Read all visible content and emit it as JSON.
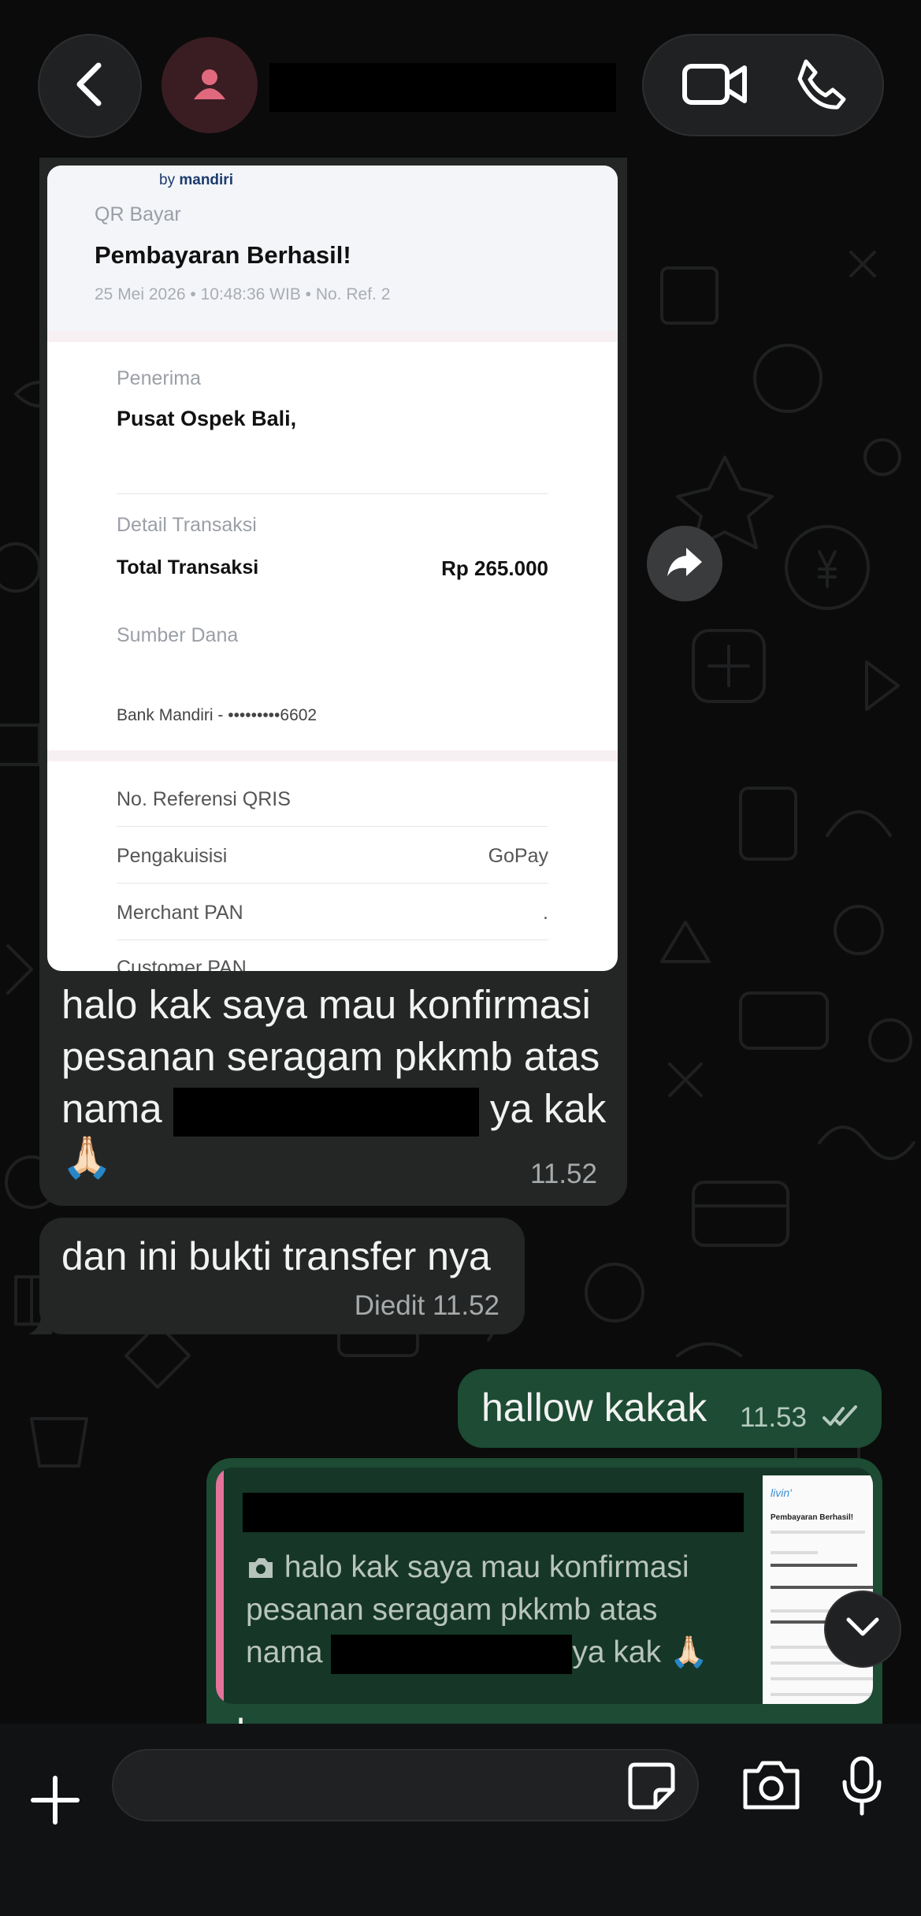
{
  "header": {
    "back_icon": "chevron-left-icon",
    "avatar_icon": "person-icon",
    "video_icon": "video-camera-icon",
    "call_icon": "phone-icon"
  },
  "receipt": {
    "logo": "mandiri",
    "logo_prefix": "by",
    "kicker": "QR Bayar",
    "title": "Pembayaran Berhasil!",
    "date_ref": "25 Mei 2026 • 10:48:36 WIB • No. Ref. 2",
    "recipient_label": "Penerima",
    "recipient_name": "Pusat Ospek Bali,",
    "detail_label": "Detail Transaksi",
    "total_label": "Total Transaksi",
    "total_value": "Rp 265.000",
    "source_label": "Sumber Dana",
    "source_value": "Bank Mandiri - •••••••••6602",
    "qris_label": "No. Referensi QRIS",
    "acquirer_label": "Pengakuisisi",
    "acquirer_value": "GoPay",
    "merchant_pan_label": "Merchant PAN",
    "merchant_pan_value": ".",
    "customer_pan_label": "Customer PAN"
  },
  "messages": {
    "msg1_line1": "halo kak saya mau konfirmasi",
    "msg1_line2": "pesanan seragam pkkmb atas",
    "msg1_line3_pre": "nama",
    "msg1_line3_post": "ya kak",
    "msg1_emoji": "🙏🏻",
    "msg1_time": "11.52",
    "msg2_text": "dan ini bukti transfer nya",
    "msg2_edited": "Diedit",
    "msg2_time": "11.52",
    "msg3_text": "hallow kakak",
    "msg3_time": "11.53",
    "reply_quote_line1": "halo kak saya mau konfirmasi",
    "reply_quote_line2": "pesanan seragam pkkmb atas",
    "reply_quote_line3_pre": "nama",
    "reply_quote_line3_post": "ya kak 🙏🏻",
    "reply_partial": "ka"
  },
  "thumb": {
    "title": "Pembayaran Berhasil!"
  },
  "composer": {
    "plus_icon": "plus-icon",
    "sticker_icon": "sticker-icon",
    "camera_icon": "camera-icon",
    "mic_icon": "microphone-icon"
  },
  "colors": {
    "incoming_bubble": "#242626",
    "outgoing_bubble": "#1d4b33",
    "quote_bar": "#e3739b",
    "background": "#0b0b0b"
  }
}
